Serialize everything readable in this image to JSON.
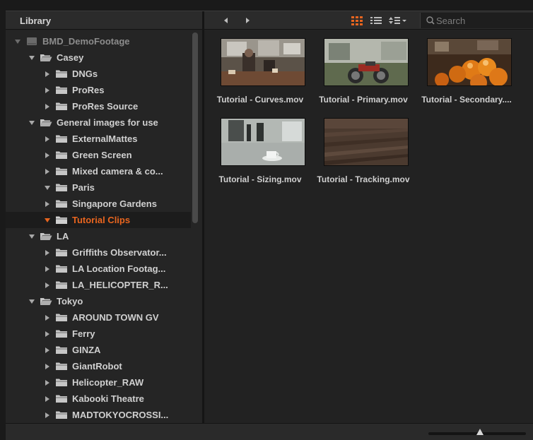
{
  "library": {
    "title": "Library",
    "tree": [
      {
        "label": "BMD_DemoFootage",
        "depth": 0,
        "expanded": true,
        "kind": "drive",
        "dim": true
      },
      {
        "label": "Casey",
        "depth": 1,
        "expanded": true,
        "kind": "folder-open"
      },
      {
        "label": "DNGs",
        "depth": 2,
        "expanded": false,
        "kind": "folder"
      },
      {
        "label": "ProRes",
        "depth": 2,
        "expanded": false,
        "kind": "folder"
      },
      {
        "label": "ProRes Source",
        "depth": 2,
        "expanded": false,
        "kind": "folder"
      },
      {
        "label": "General images for use",
        "depth": 1,
        "expanded": true,
        "kind": "folder-open"
      },
      {
        "label": "ExternalMattes",
        "depth": 2,
        "expanded": false,
        "kind": "folder"
      },
      {
        "label": "Green Screen",
        "depth": 2,
        "expanded": false,
        "kind": "folder"
      },
      {
        "label": "Mixed camera & co...",
        "depth": 2,
        "expanded": false,
        "kind": "folder"
      },
      {
        "label": "Paris",
        "depth": 2,
        "expanded": true,
        "kind": "folder"
      },
      {
        "label": "Singapore Gardens",
        "depth": 2,
        "expanded": false,
        "kind": "folder"
      },
      {
        "label": "Tutorial Clips",
        "depth": 2,
        "expanded": true,
        "kind": "folder",
        "selected": true
      },
      {
        "label": "LA",
        "depth": 1,
        "expanded": true,
        "kind": "folder-open"
      },
      {
        "label": "Griffiths Observator...",
        "depth": 2,
        "expanded": false,
        "kind": "folder"
      },
      {
        "label": "LA Location Footag...",
        "depth": 2,
        "expanded": false,
        "kind": "folder"
      },
      {
        "label": "LA_HELICOPTER_R...",
        "depth": 2,
        "expanded": false,
        "kind": "folder"
      },
      {
        "label": "Tokyo",
        "depth": 1,
        "expanded": true,
        "kind": "folder-open"
      },
      {
        "label": "AROUND TOWN GV",
        "depth": 2,
        "expanded": false,
        "kind": "folder"
      },
      {
        "label": "Ferry",
        "depth": 2,
        "expanded": false,
        "kind": "folder"
      },
      {
        "label": "GINZA",
        "depth": 2,
        "expanded": false,
        "kind": "folder"
      },
      {
        "label": "GiantRobot",
        "depth": 2,
        "expanded": false,
        "kind": "folder"
      },
      {
        "label": "Helicopter_RAW",
        "depth": 2,
        "expanded": false,
        "kind": "folder"
      },
      {
        "label": "Kabooki Theatre",
        "depth": 2,
        "expanded": false,
        "kind": "folder"
      },
      {
        "label": "MADTOKYOCROSSI...",
        "depth": 2,
        "expanded": false,
        "kind": "folder"
      }
    ]
  },
  "toolbar": {
    "back_icon": "chevron-left-icon",
    "forward_icon": "chevron-right-icon",
    "grid_view_icon": "grid-view-icon",
    "list_view_icon": "list-view-icon",
    "sort_icon": "sort-menu-icon",
    "search_placeholder": "Search",
    "accent_color": "#e8651f"
  },
  "media": {
    "clips": [
      {
        "name": "Tutorial - Curves.mov",
        "scene": "cafe"
      },
      {
        "name": "Tutorial - Primary.mov",
        "scene": "motorbike"
      },
      {
        "name": "Tutorial - Secondary....",
        "scene": "oranges"
      },
      {
        "name": "Tutorial - Sizing.mov",
        "scene": "table-cup"
      },
      {
        "name": "Tutorial - Tracking.mov",
        "scene": "wood"
      }
    ]
  },
  "footer": {
    "zoom_level": 0.53
  }
}
